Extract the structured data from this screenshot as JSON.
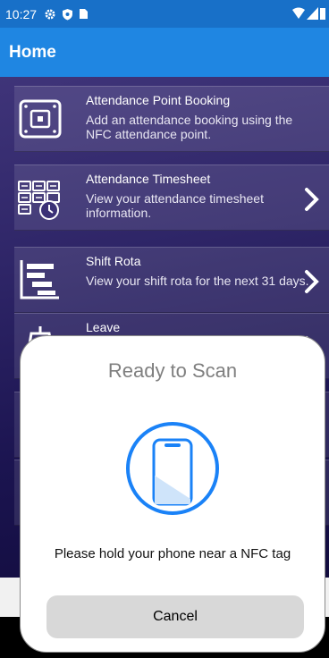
{
  "status_bar": {
    "time": "10:27",
    "icons": [
      "gear-icon",
      "shield-icon",
      "sim-card-icon",
      "wifi-icon",
      "signal-icon",
      "battery-icon"
    ]
  },
  "app_bar": {
    "title": "Home"
  },
  "tiles": [
    {
      "title": "Attendance Point Booking",
      "description": "Add an attendance booking using the NFC attendance point.",
      "icon": "nfc-reader-icon",
      "has_chevron": false
    },
    {
      "title": "Attendance Timesheet",
      "description": "View your attendance timesheet information.",
      "icon": "timesheet-icon",
      "has_chevron": true
    },
    {
      "title": "Shift Rota",
      "description": "View your shift rota for the next 31 days.",
      "icon": "shift-rota-icon",
      "has_chevron": true
    },
    {
      "title": "Leave",
      "description": "",
      "icon": "leave-icon",
      "has_chevron": true
    }
  ],
  "scan_sheet": {
    "title": "Ready to Scan",
    "message": "Please hold your phone near a NFC tag",
    "cancel_label": "Cancel",
    "icon": "phone-scan-icon",
    "accent_color": "#1a82f7"
  }
}
